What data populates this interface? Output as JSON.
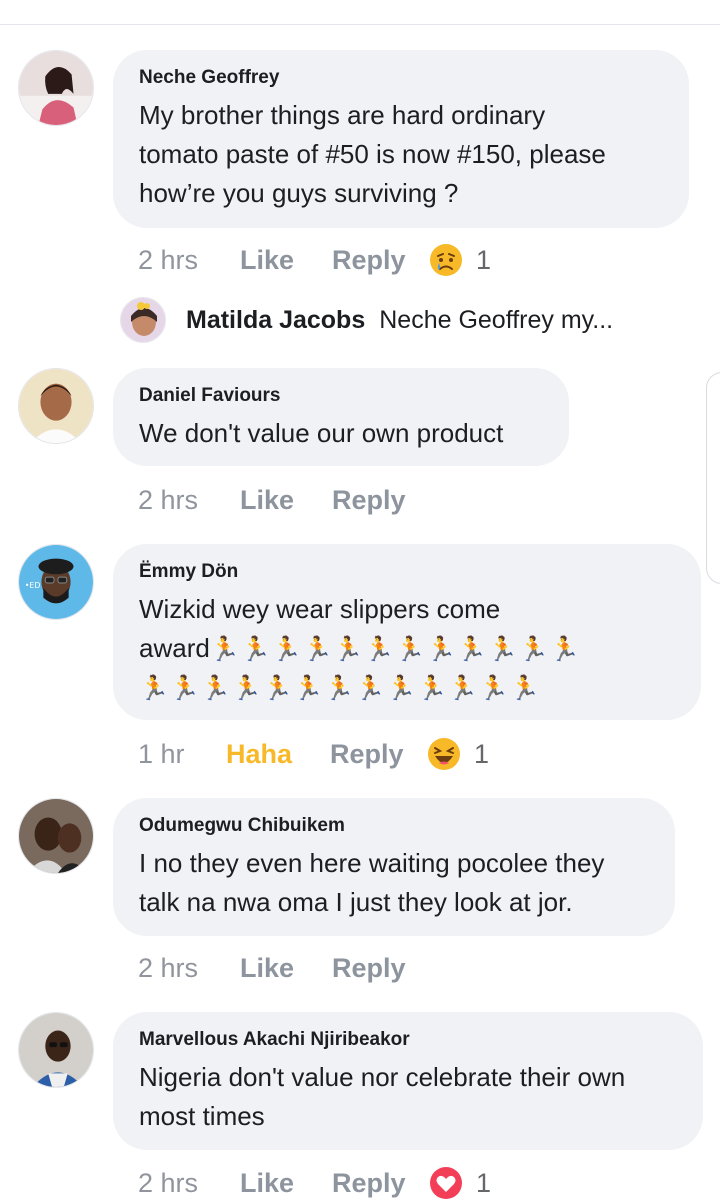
{
  "comments": [
    {
      "name": "Neche Geoffrey",
      "lines": [
        "My brother things are hard ordinary",
        "tomato paste of #50 is now #150, please",
        "how’re you guys surviving ?"
      ],
      "time": "2 hrs",
      "action": "Like",
      "reply": "Reply",
      "reaction": "sad",
      "reaction_count": "1"
    },
    {
      "name": "Daniel Faviours",
      "lines": [
        "We don't value our own product"
      ],
      "time": "2 hrs",
      "action": "Like",
      "reply": "Reply"
    },
    {
      "name": "Ëmmy Dön",
      "lines": [
        "Wizkid wey wear slippers come",
        "award"
      ],
      "emoji_line1": "🏃🏃🏃🏃🏃🏃🏃🏃🏃🏃🏃🏃",
      "emoji_line2": "🏃🏃🏃🏃🏃🏃🏃🏃🏃🏃🏃🏃🏃",
      "time": "1 hr",
      "action": "Haha",
      "reply": "Reply",
      "reaction": "haha",
      "reaction_count": "1"
    },
    {
      "name": "Odumegwu Chibuikem",
      "lines": [
        "I no they even here waiting pocolee they",
        "talk na nwa oma I just they look at jor."
      ],
      "time": "2 hrs",
      "action": "Like",
      "reply": "Reply"
    },
    {
      "name": "Marvellous Akachi Njiribeakor",
      "lines": [
        "Nigeria don't value nor celebrate their own",
        "most times"
      ],
      "time": "2 hrs",
      "action": "Like",
      "reply": "Reply",
      "reaction": "love",
      "reaction_count": "1"
    }
  ],
  "reply_preview": {
    "name": "Matilda Jacobs",
    "text": "Neche Geoffrey my..."
  },
  "colors": {
    "bubble": "#f0f2f5",
    "action_gray": "#8d949e",
    "haha_active": "#f7b928",
    "love_red": "#f33e58"
  }
}
